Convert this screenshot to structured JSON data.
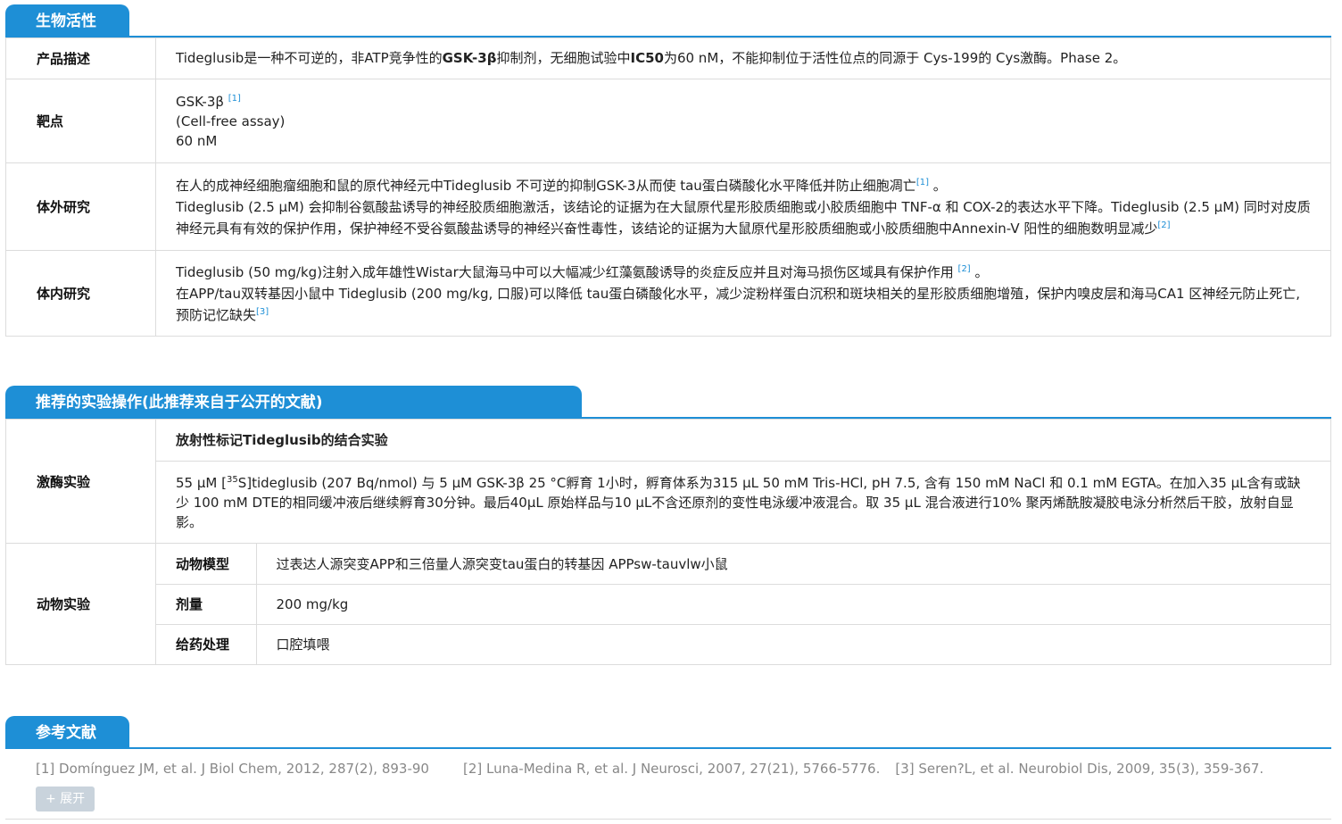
{
  "bio": {
    "tab_title": "生物活性",
    "desc_label": "产品描述",
    "desc": {
      "p1": "Tideglusib是一种不可逆的，非ATP竞争性的",
      "b1": "GSK-3β",
      "p2": "抑制剂，无细胞试验中",
      "b2": "IC50",
      "p3": "为60 nM，不能抑制位于活性位点的同源于 Cys-199的 Cys激酶。Phase 2。"
    },
    "target_label": "靶点",
    "target": {
      "line1": "GSK-3β",
      "ref1": "[1]",
      "line2": "(Cell-free assay)",
      "line3": "60 nM"
    },
    "invitro_label": "体外研究",
    "invitro": {
      "t1": "在人的成神经细胞瘤细胞和鼠的原代神经元中Tideglusib 不可逆的抑制GSK-3从而使 tau蛋白磷酸化水平降低并防止细胞凋亡",
      "r1": "[1]",
      "t1b": " 。",
      "t2": "Tideglusib (2.5 μM) 会抑制谷氨酸盐诱导的神经胶质细胞激活，该结论的证据为在大鼠原代星形胶质细胞或小胶质细胞中 TNF-α 和 COX-2的表达水平下降。Tideglusib (2.5 μM) 同时对皮质神经元具有有效的保护作用，保护神经不受谷氨酸盐诱导的神经兴奋性毒性，该结论的证据为大鼠原代星形胶质细胞或小胶质细胞中Annexin-V 阳性的细胞数明显减少",
      "r2": "[2]"
    },
    "invivo_label": "体内研究",
    "invivo": {
      "t1": "Tideglusib (50 mg/kg)注射入成年雄性Wistar大鼠海马中可以大幅减少红藻氨酸诱导的炎症反应并且对海马损伤区域具有保护作用 ",
      "r1": "[2]",
      "t1b": " 。",
      "t2": "在APP/tau双转基因小鼠中 Tideglusib (200 mg/kg, 口服)可以降低 tau蛋白磷酸化水平，减少淀粉样蛋白沉积和斑块相关的星形胶质细胞增殖，保护内嗅皮层和海马CA1 区神经元防止死亡, 预防记忆缺失",
      "r2": "[3]"
    }
  },
  "protocol": {
    "tab_title": "推荐的实验操作(此推荐来自于公开的文献)",
    "kinase_label": "激酶实验",
    "kinase_title": "放射性标记Tideglusib的结合实验",
    "kinase": {
      "p1": "55 μM [",
      "sup": "35",
      "p2": "S]tideglusib (207 Bq/nmol) 与 5 μM GSK-3β 25 °C孵育 1小时，孵育体系为315 μL 50 mM Tris-HCl, pH 7.5, 含有 150 mM NaCl 和 0.1 mM EGTA。在加入35 μL含有或缺少 100 mM DTE的相同缓冲液后继续孵育30分钟。最后40μL 原始样品与10 μL不含还原剂的变性电泳缓冲液混合。取 35 μL 混合液进行10% 聚丙烯酰胺凝胶电泳分析然后干胶，放射自显影。"
    },
    "animal_label": "动物实验",
    "animal_rows": [
      {
        "label": "动物模型",
        "value": "过表达人源突变APP和三倍量人源突变tau蛋白的转基因 APPsw-tauvlw小鼠"
      },
      {
        "label": "剂量",
        "value": "200 mg/kg"
      },
      {
        "label": "给药处理",
        "value": "口腔填喂"
      }
    ]
  },
  "refs": {
    "tab_title": "参考文献",
    "items": [
      "[1] Domínguez JM, et al. J Biol Chem, 2012, 287(2), 893-90",
      "[2] Luna-Medina R, et al. J Neurosci, 2007, 27(21), 5766-5776.",
      "[3] Seren?L, et al. Neurobiol Dis, 2009, 35(3), 359-367."
    ],
    "expand_label": "+ 展开"
  },
  "colors": {
    "accent": "#1e8fd6",
    "border": "#dcdcdc",
    "ref_text": "#888888",
    "button": "#c9d3dc"
  }
}
